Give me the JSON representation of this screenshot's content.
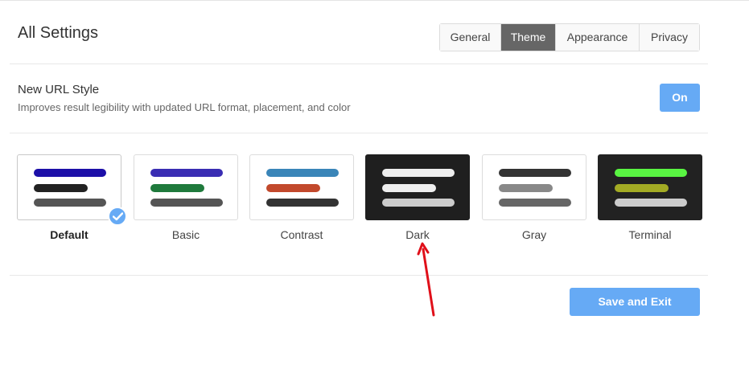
{
  "header": {
    "title": "All Settings"
  },
  "tabs": [
    {
      "label": "General",
      "active": false
    },
    {
      "label": "Theme",
      "active": true
    },
    {
      "label": "Appearance",
      "active": false
    },
    {
      "label": "Privacy",
      "active": false
    }
  ],
  "url_style": {
    "name": "New URL Style",
    "description": "Improves result legibility with updated URL format, placement, and color",
    "toggle_label": "On"
  },
  "themes": [
    {
      "label": "Default",
      "selected": true,
      "bg": "#ffffff",
      "bars": [
        "#1c0fa8",
        "#222222",
        "#555555"
      ]
    },
    {
      "label": "Basic",
      "selected": false,
      "bg": "#ffffff",
      "bars": [
        "#3a2db3",
        "#1f7a3c",
        "#555555"
      ]
    },
    {
      "label": "Contrast",
      "selected": false,
      "bg": "#ffffff",
      "bars": [
        "#3a85b8",
        "#c2492c",
        "#333333"
      ]
    },
    {
      "label": "Dark",
      "selected": false,
      "bg": "#1f1f1f",
      "bars": [
        "#eeeeee",
        "#eeeeee",
        "#cccccc"
      ]
    },
    {
      "label": "Gray",
      "selected": false,
      "bg": "#ffffff",
      "bars": [
        "#333333",
        "#888888",
        "#666666"
      ]
    },
    {
      "label": "Terminal",
      "selected": false,
      "bg": "#222222",
      "bars": [
        "#59f542",
        "#a3ab24",
        "#cccccc"
      ]
    }
  ],
  "footer": {
    "save_label": "Save and Exit"
  },
  "colors": {
    "accent": "#66aaf5",
    "active_tab": "#666666",
    "annotation_arrow": "#e0101a"
  }
}
